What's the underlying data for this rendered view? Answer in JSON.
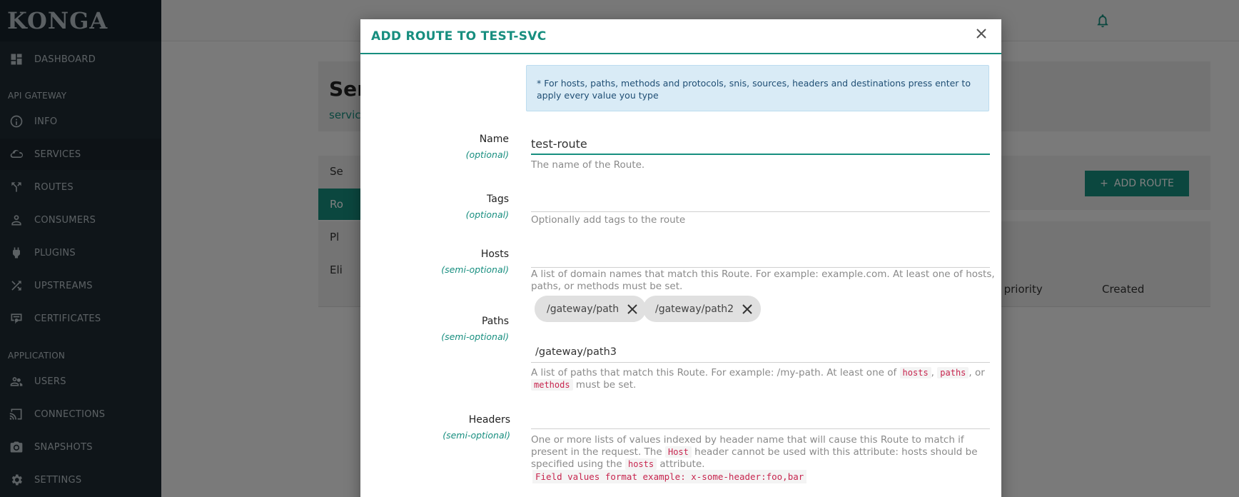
{
  "sidebar": {
    "brand": "KONGA",
    "sections": [
      "API GATEWAY",
      "APPLICATION"
    ],
    "items": [
      {
        "label": "DASHBOARD",
        "icon": "dashboard-icon"
      },
      {
        "label": "INFO",
        "icon": "info-icon"
      },
      {
        "label": "SERVICES",
        "icon": "cloud-icon"
      },
      {
        "label": "ROUTES",
        "icon": "routes-icon"
      },
      {
        "label": "CONSUMERS",
        "icon": "person-icon"
      },
      {
        "label": "PLUGINS",
        "icon": "plug-icon"
      },
      {
        "label": "UPSTREAMS",
        "icon": "shuffle-icon"
      },
      {
        "label": "CERTIFICATES",
        "icon": "certificate-icon"
      },
      {
        "label": "USERS",
        "icon": "users-icon"
      },
      {
        "label": "CONNECTIONS",
        "icon": "cast-icon"
      },
      {
        "label": "SNAPSHOTS",
        "icon": "camera-icon"
      },
      {
        "label": "SETTINGS",
        "icon": "gear-icon"
      }
    ]
  },
  "background": {
    "title": "Ser",
    "breadcrumb": "service",
    "tabs": [
      "Se",
      "Ro",
      "Pl",
      "Eli"
    ],
    "add_route_label": "ADD ROUTE",
    "columns": [
      "ex priority",
      "Created"
    ]
  },
  "modal": {
    "title": "ADD ROUTE TO TEST-SVC",
    "info": "* For hosts, paths, methods and protocols, snis, sources, headers and destinations press enter to apply every value you type",
    "fields": {
      "name": {
        "label": "Name",
        "sub": "(optional)",
        "value": "test-route",
        "help": "The name of the Route."
      },
      "tags": {
        "label": "Tags",
        "sub": "(optional)",
        "value": "",
        "help": "Optionally add tags to the route"
      },
      "hosts": {
        "label": "Hosts",
        "sub": "(semi-optional)",
        "value": "",
        "help": "A list of domain names that match this Route. For example: example.com. At least one of hosts, paths, or methods must be set."
      },
      "paths": {
        "label": "Paths",
        "sub": "(semi-optional)",
        "chips": [
          "/gateway/path",
          "/gateway/path2"
        ],
        "input_value": "/gateway/path3",
        "help_prefix": "A list of paths that match this Route. For example: /my-path. At least one of",
        "code1": "hosts",
        "code2": "paths",
        "code3": "methods",
        "sep1": ",",
        "sep2": ", or",
        "help_suffix": "must be set."
      },
      "headers": {
        "label": "Headers",
        "sub": "(semi-optional)",
        "value": "",
        "help_prefix": "One or more lists of values indexed by header name that will cause this Route to match if present in the request. The",
        "code1": "Host",
        "help_mid": "header cannot be used with this attribute: hosts should be specified using the",
        "code2": "hosts",
        "help_suffix": "attribute.",
        "example": "Field values format example: x-some-header:foo,bar"
      }
    }
  }
}
